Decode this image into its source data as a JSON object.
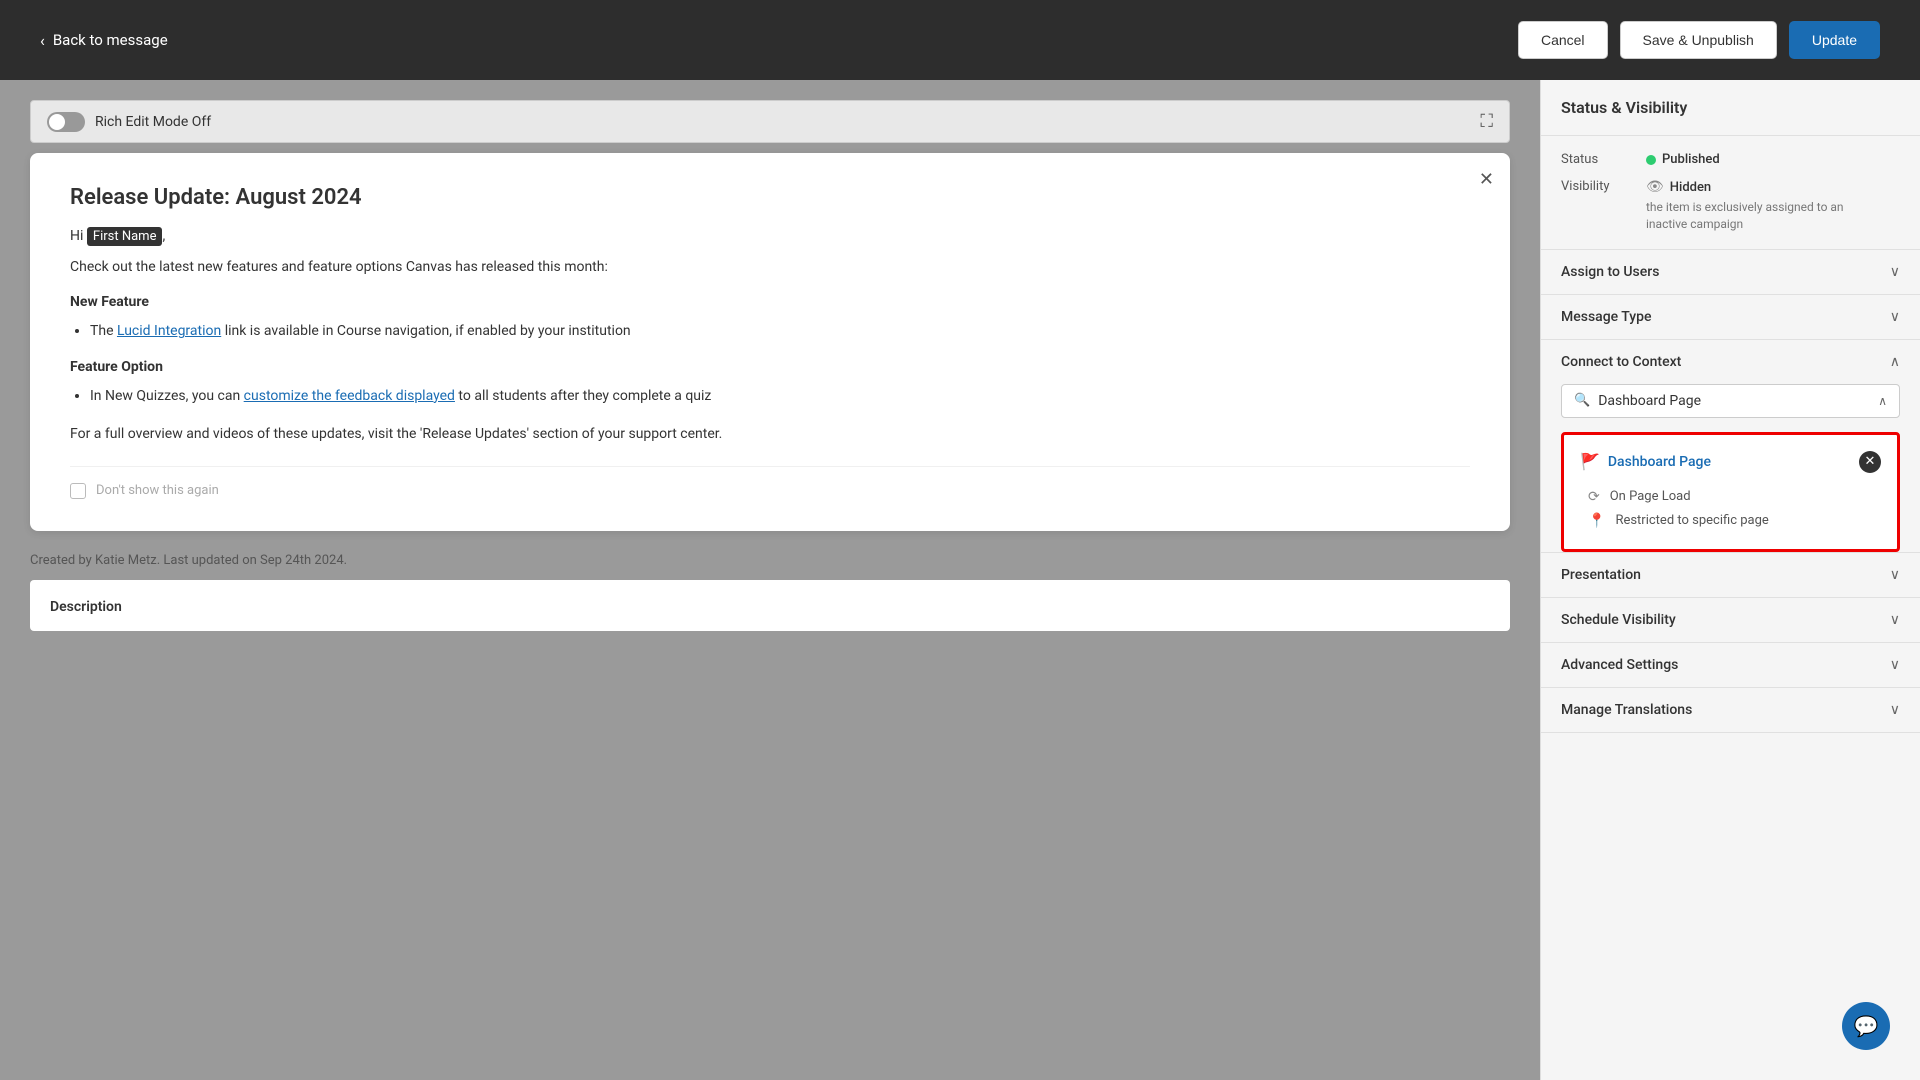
{
  "topbar": {
    "back_label": "Back to message",
    "cancel_label": "Cancel",
    "save_unpublish_label": "Save & Unpublish",
    "update_label": "Update"
  },
  "editor": {
    "rich_edit_label": "Rich Edit Mode Off"
  },
  "message": {
    "title": "Release Update: August 2024",
    "greeting": "Hi",
    "first_name": "First Name",
    "intro": "Check out the latest new features and feature options Canvas has released this month:",
    "section1_title": "New Feature",
    "section1_items": [
      {
        "text_before": "The ",
        "link_text": "Lucid Integration",
        "text_after": " link is available in Course navigation, if enabled by your institution"
      }
    ],
    "section2_title": "Feature Option",
    "section2_items": [
      {
        "text_before": "In New Quizzes, you can ",
        "link_text": "customize the feedback displayed",
        "text_after": " to all students after they complete a quiz"
      }
    ],
    "footer_text": "For a full overview and videos of these updates, visit the 'Release Updates' section of your support center.",
    "dont_show_label": "Don't show this again"
  },
  "footer": {
    "created_by": "Created by Katie Metz. Last updated on Sep 24th 2024."
  },
  "description": {
    "title": "Description"
  },
  "sidebar": {
    "header": "Status & Visibility",
    "status_label": "Status",
    "status_value": "Published",
    "visibility_label": "Visibility",
    "visibility_value": "Hidden",
    "visibility_desc": "the item is exclusively assigned to an inactive campaign",
    "assign_users_label": "Assign to Users",
    "message_type_label": "Message Type",
    "connect_context_label": "Connect to Context",
    "context_search_value": "Dashboard Page",
    "context_item_label": "Dashboard Page",
    "on_page_load_label": "On Page Load",
    "restricted_label": "Restricted to specific page",
    "presentation_label": "Presentation",
    "schedule_visibility_label": "Schedule Visibility",
    "advanced_settings_label": "Advanced Settings",
    "manage_translations_label": "Manage Translations"
  }
}
